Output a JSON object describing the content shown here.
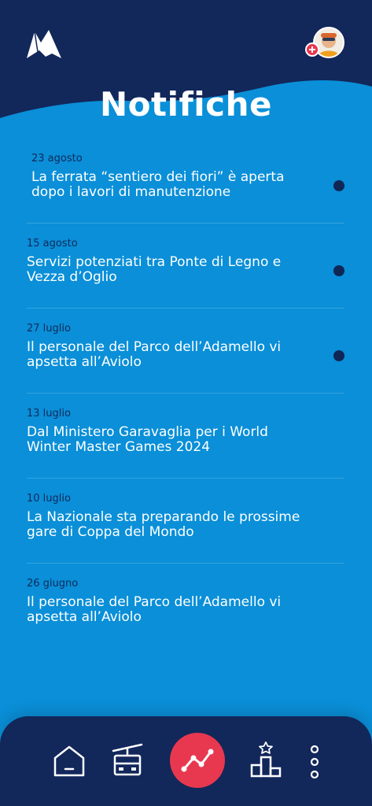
{
  "header": {
    "logo_icon": "mountain-logo",
    "avatar_icon": "user-avatar",
    "add_icon": "plus-icon",
    "title": "Notifiche"
  },
  "notifications": [
    {
      "date": "23 agosto",
      "text": "La ferrata “sentiero dei fiori” è aperta dopo i lavori di manutenzione",
      "unread": true
    },
    {
      "date": "15 agosto",
      "text": "Servizi potenziati tra Ponte di Legno e Vezza d’Oglio",
      "unread": true
    },
    {
      "date": "27 luglio",
      "text": "Il personale del Parco dell’Adamello vi apsetta all’Aviolo",
      "unread": true
    },
    {
      "date": "13 luglio",
      "text": "Dal Ministero Garavaglia per i World Winter Master Games 2024",
      "unread": false
    },
    {
      "date": "10 luglio",
      "text": "La Nazionale sta preparando le prossime gare di Coppa del Mondo",
      "unread": false
    },
    {
      "date": "26 giugno",
      "text": "Il personale del Parco dell’Adamello vi apsetta all’Aviolo",
      "unread": false
    }
  ],
  "navbar": {
    "items": [
      "home-icon",
      "cable-car-icon",
      "stats-icon",
      "podium-icon",
      "more-icon"
    ],
    "active": "stats-icon"
  },
  "colors": {
    "background": "#0a8fd8",
    "header": "#12275a",
    "accent": "#e8384f",
    "unread_dot": "#102655",
    "date_text": "#0f2a5a"
  }
}
